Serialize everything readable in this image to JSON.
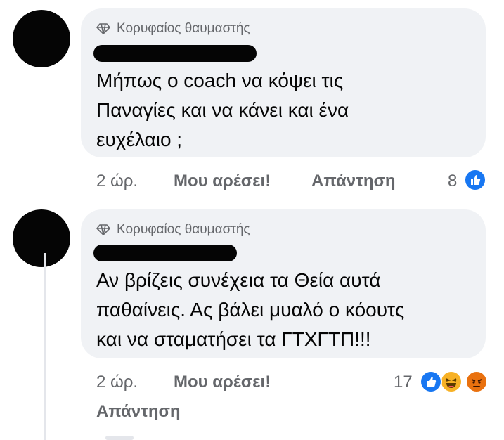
{
  "comments": [
    {
      "badge_icon": "diamond-icon",
      "badge": "Κορυφαίος θαυμαστής",
      "text": "Μήπως ο coach να κόψει τις\nΠαναγίες και να κάνει και ένα\nευχέλαιο ;",
      "time": "2 ώρ.",
      "like_label": "Μου αρέσει!",
      "reply_label": "Απάντηση",
      "reaction_count": "8",
      "reactions": [
        "like-icon"
      ]
    },
    {
      "badge_icon": "diamond-icon",
      "badge": "Κορυφαίος θαυμαστής",
      "text": "Αν βρίζεις συνέχεια τα Θεία αυτά\nπαθαίνεις. Ας βάλει μυαλό ο κόουτς\nκαι να σταματήσει τα ΓΤΧΓΤΠ!!!",
      "time": "2 ώρ.",
      "like_label": "Μου αρέσει!",
      "reply_label": "Απάντηση",
      "reaction_count": "17",
      "reactions": [
        "like-icon",
        "haha-icon",
        "angry-icon"
      ]
    }
  ],
  "colors": {
    "bubble": "#f0f2f5",
    "meta_text": "#65676b",
    "like_blue": "#1877f2",
    "haha_yellow": "#f7b125",
    "angry_orange": "#e9710f"
  }
}
